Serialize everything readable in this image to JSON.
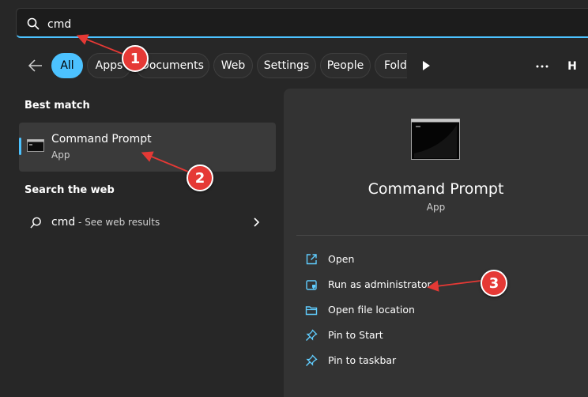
{
  "search": {
    "value": "cmd"
  },
  "filters": [
    {
      "label": "All",
      "active": true
    },
    {
      "label": "Apps"
    },
    {
      "label": "Documents"
    },
    {
      "label": "Web"
    },
    {
      "label": "Settings"
    },
    {
      "label": "People"
    },
    {
      "label": "Folders"
    }
  ],
  "user": {
    "initial": "H"
  },
  "best_match": {
    "heading": "Best match",
    "title": "Command Prompt",
    "subtitle": "App"
  },
  "web": {
    "heading": "Search the web",
    "query": "cmd",
    "suffix": " - See web results"
  },
  "detail": {
    "title": "Command Prompt",
    "subtitle": "App",
    "actions": [
      {
        "label": "Open",
        "icon": "open-external-icon"
      },
      {
        "label": "Run as administrator",
        "icon": "shield-icon"
      },
      {
        "label": "Open file location",
        "icon": "folder-icon"
      },
      {
        "label": "Pin to Start",
        "icon": "pin-icon"
      },
      {
        "label": "Pin to taskbar",
        "icon": "pin-icon"
      }
    ]
  },
  "annotations": [
    "1",
    "2",
    "3"
  ],
  "colors": {
    "accent": "#4cc2ff",
    "badge": "#e53935",
    "background": "#272727",
    "pane": "#333333"
  }
}
